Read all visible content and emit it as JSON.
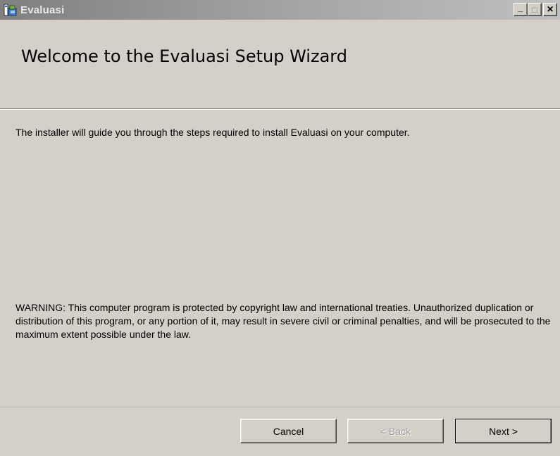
{
  "window": {
    "title": "Evaluasi",
    "minimize_glyph": "_",
    "maximize_glyph": "□",
    "close_glyph": "×",
    "icon": "installer-icon"
  },
  "header": {
    "title": "Welcome to the Evaluasi Setup Wizard"
  },
  "content": {
    "intro": "The installer will guide you through the steps required to install Evaluasi on your computer.",
    "warning": "WARNING: This computer program is protected by copyright law and international treaties. Unauthorized duplication or distribution of this program, or any portion of it, may result in severe civil or criminal penalties, and will be prosecuted to the maximum extent possible under the law."
  },
  "buttons": {
    "cancel": "Cancel",
    "back": "< Back",
    "next": "Next >"
  },
  "colors": {
    "dialog_bg": "#d4d0c8",
    "titlebar_inactive": "#808080",
    "disabled_text": "#a0a0a0"
  }
}
